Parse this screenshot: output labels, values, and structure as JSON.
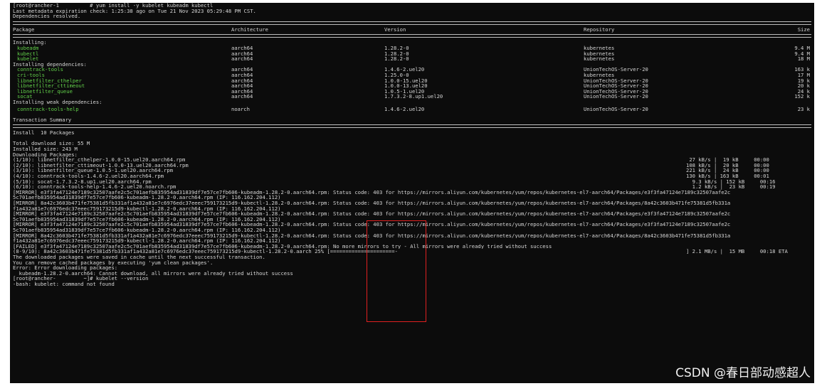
{
  "header": [
    "[root@rancher-1          # yum install -y kubelet kubeadm kubectl",
    "Last metadata expiration check: 1:25:38 ago on Tue 21 Nov 2023 05:29:48 PM CST.",
    "Dependencies resolved."
  ],
  "table": {
    "headers": {
      "package": "Package",
      "arch": "Architecture",
      "version": "Version",
      "repo": "Repository",
      "size": "Size"
    },
    "sections": [
      {
        "title": "Installing:",
        "rows": [
          {
            "name": "kubeadm",
            "arch": "aarch64",
            "version": "1.28.2-0",
            "repo": "kubernetes",
            "size": "9.4 M"
          },
          {
            "name": "kubectl",
            "arch": "aarch64",
            "version": "1.28.2-0",
            "repo": "kubernetes",
            "size": "9.4 M"
          },
          {
            "name": "kubelet",
            "arch": "aarch64",
            "version": "1.28.2-0",
            "repo": "kubernetes",
            "size": "18 M"
          }
        ]
      },
      {
        "title": "Installing dependencies:",
        "rows": [
          {
            "name": "conntrack-tools",
            "arch": "aarch64",
            "version": "1.4.6-2.uel20",
            "repo": "UnionTechOS-Server-20",
            "size": "163 k"
          },
          {
            "name": "cri-tools",
            "arch": "aarch64",
            "version": "1.25.0-0",
            "repo": "kubernetes",
            "size": "17 M"
          },
          {
            "name": "libnetfilter_cthelper",
            "arch": "aarch64",
            "version": "1.0.0-15.uel20",
            "repo": "UnionTechOS-Server-20",
            "size": "19 k"
          },
          {
            "name": "libnetfilter_cttimeout",
            "arch": "aarch64",
            "version": "1.0.0-13.uel20",
            "repo": "UnionTechOS-Server-20",
            "size": "20 k"
          },
          {
            "name": "libnetfilter_queue",
            "arch": "aarch64",
            "version": "1.0.5-1.uel20",
            "repo": "UnionTechOS-Server-20",
            "size": "24 k"
          },
          {
            "name": "socat",
            "arch": "aarch64",
            "version": "1.7.3.2-8.up1.uel20",
            "repo": "UnionTechOS-Server-20",
            "size": "152 k"
          }
        ]
      },
      {
        "title": "Installing weak dependencies:",
        "rows": [
          {
            "name": "conntrack-tools-help",
            "arch": "noarch",
            "version": "1.4.6-2.uel20",
            "repo": "UnionTechOS-Server-20",
            "size": "23 k"
          }
        ]
      }
    ]
  },
  "summary": {
    "title": "Transaction Summary",
    "install": "Install  10 Packages",
    "total_download": "Total download size: 55 M",
    "installed_size": "Installed size: 243 M",
    "downloading": "Downloading Packages:"
  },
  "downloads": [
    {
      "name": "(1/10): libnetfilter_cthelper-1.0.0-15.uel20.aarch64.rpm",
      "stat": " 27 kB/s |  19 kB     00:00"
    },
    {
      "name": "(2/10): libnetfilter_cttimeout-1.0.0-13.uel20.aarch64.rpm",
      "stat": "108 kB/s |  20 kB     00:00"
    },
    {
      "name": "(3/10): libnetfilter_queue-1.0.5-1.uel20.aarch64.rpm",
      "stat": "221 kB/s |  24 kB     00:00"
    },
    {
      "name": "(4/10): conntrack-tools-1.4.6-2.uel20.aarch64.rpm",
      "stat": "130 kB/s | 163 kB     00:01"
    },
    {
      "name": "(5/10): socat-1.7.3.2-8.up1.uel20.aarch64.rpm",
      "stat": "  9.3 kB/s | 152 kB     00:16"
    },
    {
      "name": "(6/10): conntrack-tools-help-1.4.6-2.uel20.noarch.rpm",
      "stat": "  1.2 kB/s |  23 kB     00:19"
    }
  ],
  "mirror_lines": [
    "[MIRROR] e3f3fa47124e7189c32507aafe2c5c701aefb835954ad31839df7e57ce7fb606-kubeadm-1.28.2-0.aarch64.rpm: Status code: 403 for https://mirrors.aliyun.com/kubernetes/yum/repos/kubernetes-el7-aarch64/Packages/e3f3fa47124e7189c32507aafe2c",
    "5c701aefb835954ad31839df7e57ce7fb606-kubeadm-1.28.2-0.aarch64.rpm (IP: 116.162.204.112)",
    "[MIRROR] 8a42c3603b471fe75381d5fb331af1a432a81e7c6976edc37eeec759173215d9-kubectl-1.28.2-0.aarch64.rpm: Status code: 403 for https://mirrors.aliyun.com/kubernetes/yum/repos/kubernetes-el7-aarch64/Packages/8a42c3603b471fe75381d5fb331a",
    "f1a432a81e7c6976edc37eeec759173215d9-kubectl-1.28.2-0.aarch64.rpm (IP: 116.162.204.112)",
    "[MIRROR] e3f3fa47124e7189c32507aafe2c5c701aefb835954ad31839df7e57ce7fb606-kubeadm-1.28.2-0.aarch64.rpm: Status code: 403 for https://mirrors.aliyun.com/kubernetes/yum/repos/kubernetes-el7-aarch64/Packages/e3f3fa47124e7189c32507aafe2c",
    "5c701aefb835954ad31839df7e57ce7fb606-kubeadm-1.28.2-0.aarch64.rpm (IP: 116.162.204.112)",
    "[MIRROR] e3f3fa47124e7189c32507aafe2c5c701aefb835954ad31839df7e57ce7fb606-kubeadm-1.28.2-0.aarch64.rpm: Status code: 403 for https://mirrors.aliyun.com/kubernetes/yum/repos/kubernetes-el7-aarch64/Packages/e3f3fa47124e7189c32507aafe2c",
    "5c701aefb835954ad31839df7e57ce7fb606-kubeadm-1.28.2-0.aarch64.rpm (IP: 116.162.204.112)",
    "[MIRROR] 8a42c3603b471fe75381d5fb331af1a432a81e7c6976edc37eeec759173215d9-kubectl-1.28.2-0.aarch64.rpm: Status code: 403 for https://mirrors.aliyun.com/kubernetes/yum/repos/kubernetes-el7-aarch64/Packages/8a42c3603b471fe75381d5fb331a",
    "f1a432a81e7c6976edc37eeec759173215d9-kubectl-1.28.2-0.aarch64.rpm (IP: 116.162.204.112)"
  ],
  "failed": "[FAILED] e3f3fa47124e7189c32507aafe2c5c701aefb835954ad31839df7e57ce7fb606-kubeadm-1.28.2-0.aarch64.rpm: No more mirrors to try - All mirrors were already tried without success",
  "progress": {
    "label": "(8-9/10): 8a42c3603b471fe75381d5fb331af1a432a81e7c6976edc37eeec759173215d9-kubectl-1.28.2-0.aarch 25% [=====================-",
    "stat": "] 2.1 MB/s |  15 MB     00:18 ETA"
  },
  "tail_lines": [
    "The downloaded packages were saved in cache until the next successful transaction.",
    "You can remove cached packages by executing 'yum clean packages'.",
    "Error: Error downloading packages:",
    "  kubeadm-1.28.2-0.aarch64: Cannot download, all mirrors were already tried without success",
    "[root@rancher-         ~]# kubelet --version",
    "-bash: kubelet: command not found"
  ],
  "watermark": "CSDN @春日部动感超人",
  "colors": {
    "background": "#0c0c0c",
    "text": "#d6d6d6",
    "package_name": "#62d04a",
    "highlight_box": "#e02020"
  }
}
